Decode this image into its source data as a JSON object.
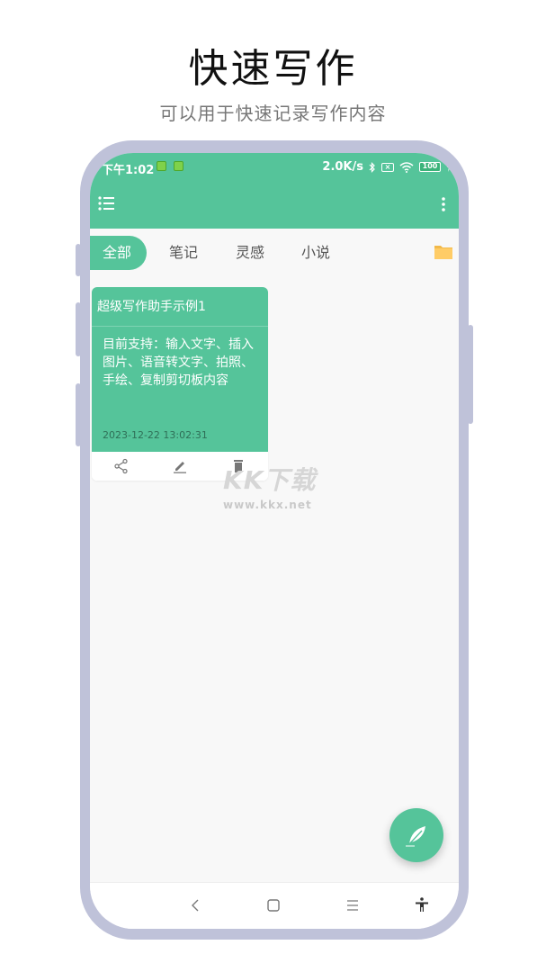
{
  "promo": {
    "title": "快速写作",
    "subtitle": "可以用于快速记录写作内容"
  },
  "status_bar": {
    "time": "下午1:02",
    "net_speed": "2.0K/s",
    "battery": "100",
    "sim_label": "×"
  },
  "app_bar": {
    "menu_icon": "list-menu-icon",
    "more_icon": "more-vertical-icon"
  },
  "tabs": [
    {
      "label": "全部",
      "active": true
    },
    {
      "label": "笔记",
      "active": false
    },
    {
      "label": "灵感",
      "active": false
    },
    {
      "label": "小说",
      "active": false
    }
  ],
  "notes": [
    {
      "title": "超级写作助手示例1",
      "content": "目前支持：输入文字、插入图片、语音转文字、拍照、手绘、复制剪切板内容",
      "timestamp": "2023-12-22 13:02:31",
      "actions": [
        "share-icon",
        "edit-icon",
        "delete-icon"
      ]
    }
  ],
  "watermark": {
    "logo": "KK下载",
    "url": "www.kkx.net"
  },
  "fab": {
    "icon": "feather-quill-icon"
  },
  "nav_bar": {
    "buttons": [
      "back-icon",
      "home-icon",
      "recents-icon",
      "accessibility-icon"
    ]
  },
  "colors": {
    "accent": "#55c49a",
    "frame": "#bfc2d9",
    "folder": "#ffcc66",
    "background": "#f8f8f8"
  }
}
